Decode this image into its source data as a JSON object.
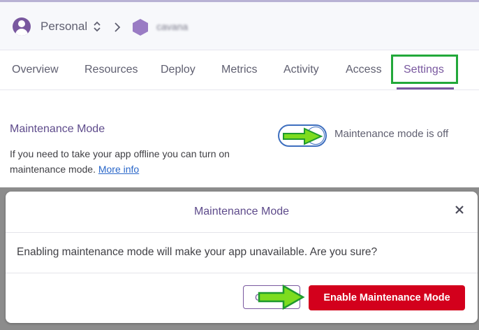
{
  "breadcrumb": {
    "account_label": "Personal",
    "app_name": "cavana"
  },
  "tabs": [
    {
      "label": "Overview"
    },
    {
      "label": "Resources"
    },
    {
      "label": "Deploy"
    },
    {
      "label": "Metrics"
    },
    {
      "label": "Activity"
    },
    {
      "label": "Access"
    },
    {
      "label": "Settings",
      "active": true
    }
  ],
  "maintenance": {
    "title": "Maintenance Mode",
    "description": "If you need to take your app offline you can turn on maintenance mode.",
    "more_info_link": "More info",
    "status": "Maintenance mode is off",
    "toggle_on": false
  },
  "modal": {
    "title": "Maintenance Mode",
    "message": "Enabling maintenance mode will make your app unavailable. Are you sure?",
    "cancel_label": "C",
    "confirm_label": "Enable Maintenance Mode"
  },
  "colors": {
    "brand_purple": "#79589f",
    "danger_red": "#d3001c",
    "highlight_green": "#22a83a",
    "annotation_arrow": "#7ddc1f"
  },
  "icons": {
    "avatar": "user-avatar-icon",
    "account_switcher": "up-down-chevron-icon",
    "separator": "chevron-right-icon",
    "app": "hexagon-icon",
    "close": "close-icon"
  }
}
